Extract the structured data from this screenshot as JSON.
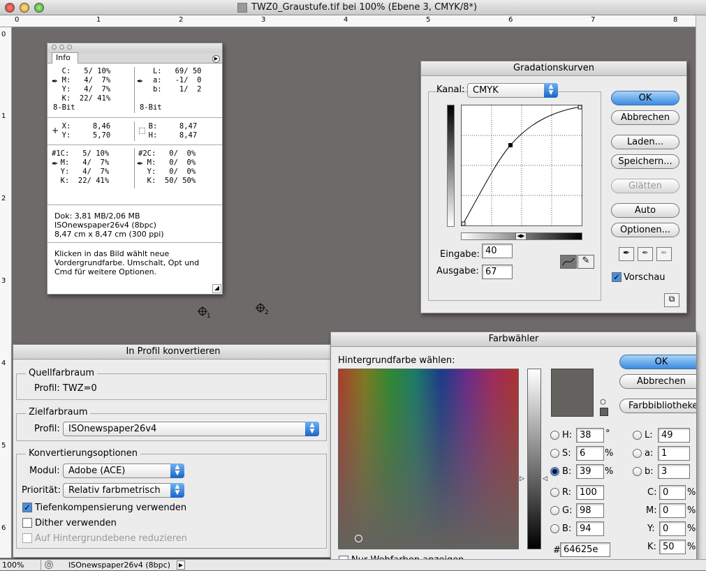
{
  "window": {
    "title": "TWZ0_Graustufe.tif bei 100% (Ebene 3, CMYK/8*)"
  },
  "ruler_h": [
    "0",
    "1",
    "2",
    "3",
    "4",
    "5",
    "6",
    "7",
    "8"
  ],
  "ruler_v": [
    "0",
    "1",
    "2",
    "3",
    "4",
    "5",
    "6"
  ],
  "info": {
    "tab": "Info",
    "block1_left": "  C:   5/ 10%\n  M:   4/  7%\n  Y:   4/  7%\n  K:  22/ 41%\n8-Bit",
    "block1_right": "   L:   69/ 50\n   a:   -1/  0\n   b:    1/  2\n\n8-Bit",
    "block2_left": "  X:     8,46\n  Y:     5,70",
    "block2_right": "  B:     8,47\n  H:     8,47",
    "block3_left": "#1C:   5/ 10%\n  M:   4/  7%\n  Y:   4/  7%\n  K:  22/ 41%",
    "block3_right": "#2C:   0/  0%\n  M:   0/  0%\n  Y:   0/  0%\n  K:  50/ 50%",
    "doc": "Dok: 3,81 MB/2,06 MB\nISOnewspaper26v4 (8bpc)\n8,47 cm x 8,47 cm (300 ppi)",
    "hint": "Klicken in das Bild wählt neue\nVordergrundfarbe. Umschalt, Opt und\nCmd für weitere Optionen."
  },
  "markers": {
    "m1": "1",
    "m2": "2"
  },
  "curves": {
    "title": "Gradationskurven",
    "kanal_label": "Kanal:",
    "kanal_value": "CMYK",
    "eingabe_label": "Eingabe:",
    "eingabe_value": "40",
    "ausgabe_label": "Ausgabe:",
    "ausgabe_value": "67",
    "ok": "OK",
    "cancel": "Abbrechen",
    "load": "Laden...",
    "save": "Speichern...",
    "smooth": "Glätten",
    "auto": "Auto",
    "options": "Optionen...",
    "preview_label": "Vorschau"
  },
  "convert": {
    "title": "In Profil konvertieren",
    "source_group": "Quellfarbraum",
    "source_profile": "Profil:  TWZ=0",
    "target_group": "Zielfarbraum",
    "profile_label": "Profil:",
    "target_profile": "ISOnewspaper26v4",
    "options_group": "Konvertierungsoptionen",
    "modul_label": "Modul:",
    "modul_value": "Adobe (ACE)",
    "prio_label": "Priorität:",
    "prio_value": "Relativ farbmetrisch",
    "blackpoint": "Tiefenkompensierung verwenden",
    "dither": "Dither verwenden",
    "flatten": "Auf Hintergrundebene reduzieren"
  },
  "picker": {
    "title": "Farbwähler",
    "prompt": "Hintergrundfarbe wählen:",
    "ok": "OK",
    "cancel": "Abbrechen",
    "libraries": "Farbbibliotheken",
    "H": "38",
    "S": "6",
    "B": "39",
    "R": "100",
    "G": "98",
    "Bl": "94",
    "L": "49",
    "a": "1",
    "b": "3",
    "C": "0",
    "M": "0",
    "Y": "0",
    "K": "50",
    "hex": "64625e",
    "web_only": "Nur Webfarben anzeigen",
    "swatch_color": "#64625e"
  },
  "status": {
    "zoom": "100%",
    "profile": "ISOnewspaper26v4 (8bpc)"
  }
}
